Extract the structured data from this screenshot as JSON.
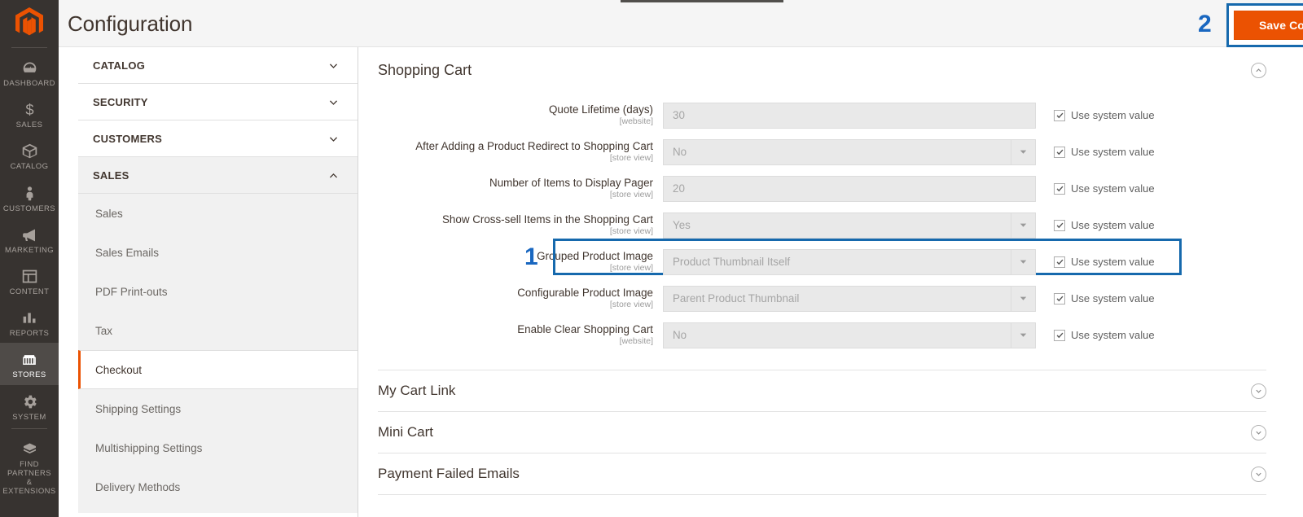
{
  "rail": {
    "logo_name": "magento-logo",
    "items": [
      {
        "label": "Dashboard",
        "icon": "dashboard-icon",
        "active": false
      },
      {
        "label": "Sales",
        "icon": "sales-icon",
        "active": false
      },
      {
        "label": "Catalog",
        "icon": "catalog-icon",
        "active": false
      },
      {
        "label": "Customers",
        "icon": "customers-icon",
        "active": false
      },
      {
        "label": "Marketing",
        "icon": "marketing-icon",
        "active": false
      },
      {
        "label": "Content",
        "icon": "content-icon",
        "active": false
      },
      {
        "label": "Reports",
        "icon": "reports-icon",
        "active": false
      },
      {
        "label": "Stores",
        "icon": "stores-icon",
        "active": true
      },
      {
        "label": "System",
        "icon": "system-icon",
        "active": false
      },
      {
        "label": "Find Partners\n& Extensions",
        "icon": "partners-icon",
        "active": false
      }
    ],
    "partners_line1": "FIND PARTNERS",
    "partners_line2": "& EXTENSIONS"
  },
  "header": {
    "title": "Configuration",
    "save_label": "Save Config",
    "marker": "2"
  },
  "config_nav": {
    "sections": [
      {
        "label": "CATALOG",
        "state": "collapsed"
      },
      {
        "label": "SECURITY",
        "state": "collapsed"
      },
      {
        "label": "CUSTOMERS",
        "state": "collapsed"
      },
      {
        "label": "SALES",
        "state": "expanded"
      }
    ],
    "sub_items": [
      {
        "label": "Sales",
        "active": false
      },
      {
        "label": "Sales Emails",
        "active": false
      },
      {
        "label": "PDF Print-outs",
        "active": false
      },
      {
        "label": "Tax",
        "active": false
      },
      {
        "label": "Checkout",
        "active": true
      },
      {
        "label": "Shipping Settings",
        "active": false
      },
      {
        "label": "Multishipping Settings",
        "active": false
      },
      {
        "label": "Delivery Methods",
        "active": false
      }
    ]
  },
  "main": {
    "group_title": "Shopping Cart",
    "group_toggle_icon": "chevron-up-circle-icon",
    "marker": "1",
    "system_value_label": "Use system value",
    "fields": [
      {
        "label": "Quote Lifetime (days)",
        "scope": "[website]",
        "value": "30",
        "type": "text",
        "use_system_value": true,
        "highlighted": false
      },
      {
        "label": "After Adding a Product Redirect to Shopping Cart",
        "scope": "[store view]",
        "value": "No",
        "type": "select",
        "use_system_value": true,
        "highlighted": false
      },
      {
        "label": "Number of Items to Display Pager",
        "scope": "[store view]",
        "value": "20",
        "type": "text",
        "use_system_value": true,
        "highlighted": false
      },
      {
        "label": "Show Cross-sell Items in the Shopping Cart",
        "scope": "[store view]",
        "value": "Yes",
        "type": "select",
        "use_system_value": true,
        "highlighted": false
      },
      {
        "label": "Grouped Product Image",
        "scope": "[store view]",
        "value": "Product Thumbnail Itself",
        "type": "select",
        "use_system_value": true,
        "highlighted": true
      },
      {
        "label": "Configurable Product Image",
        "scope": "[store view]",
        "value": "Parent Product Thumbnail",
        "type": "select",
        "use_system_value": true,
        "highlighted": false
      },
      {
        "label": "Enable Clear Shopping Cart",
        "scope": "[website]",
        "value": "No",
        "type": "select",
        "use_system_value": true,
        "highlighted": false
      }
    ],
    "collapsed_sections": [
      {
        "label": "My Cart Link",
        "toggle_icon": "chevron-down-circle-icon"
      },
      {
        "label": "Mini Cart",
        "toggle_icon": "chevron-down-circle-icon"
      },
      {
        "label": "Payment Failed Emails",
        "toggle_icon": "chevron-down-circle-icon"
      }
    ]
  },
  "colors": {
    "accent_orange": "#eb5202",
    "highlight_blue": "#1669ad",
    "marker_blue": "#1967c0",
    "rail_bg": "#373330"
  }
}
